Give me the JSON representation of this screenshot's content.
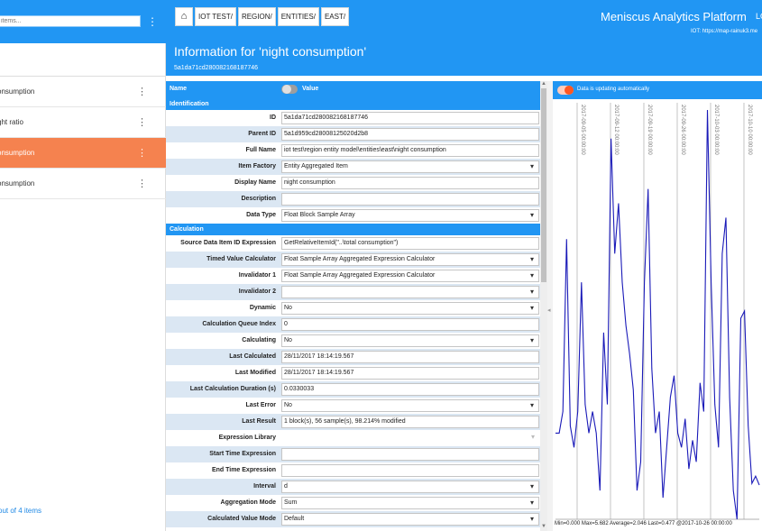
{
  "sidebar": {
    "search_placeholder": "items...",
    "items": [
      {
        "label": "onsumption",
        "active": false
      },
      {
        "label": "ght ratio",
        "active": false
      },
      {
        "label": "onsumption",
        "active": true
      },
      {
        "label": "onsumption",
        "active": false
      }
    ],
    "count_label": "out of 4 items"
  },
  "breadcrumbs": [
    "IOT TEST/",
    "REGION/",
    "ENTITIES/",
    "EAST/"
  ],
  "header": {
    "app_title": "Meniscus Analytics Platform",
    "user": "LO",
    "iot_url": "IOT: https://map-rainuk3.me",
    "page_title": "Information for 'night consumption'",
    "page_id": "5a1da71cd280082168187746"
  },
  "table": {
    "name_header": "Name",
    "value_header": "Value",
    "sections": [
      {
        "title": "Identification",
        "rows": [
          {
            "key": "ID",
            "value": "5a1da71cd280082168187746",
            "kind": "text"
          },
          {
            "key": "Parent ID",
            "value": "5a1d959cd28008125020d2b8",
            "kind": "text"
          },
          {
            "key": "Full Name",
            "value": "iot test\\region entity model\\entities\\east\\night consumption",
            "kind": "text"
          },
          {
            "key": "Item Factory",
            "value": "Entity Aggregated Item",
            "kind": "select"
          },
          {
            "key": "Display Name",
            "value": "night consumption",
            "kind": "text"
          },
          {
            "key": "Description",
            "value": "",
            "kind": "text"
          },
          {
            "key": "Data Type",
            "value": "Float Block Sample Array",
            "kind": "select"
          }
        ]
      },
      {
        "title": "Calculation",
        "rows": [
          {
            "key": "Source Data Item ID Expression",
            "value": "GetRelativeItemId(\"..\\total consumption\")",
            "kind": "text"
          },
          {
            "key": "Timed Value Calculator",
            "value": "Float Sample Array Aggregated Expression Calculator",
            "kind": "select"
          },
          {
            "key": "Invalidator 1",
            "value": "Float Sample Array Aggregated Expression Calculator",
            "kind": "select"
          },
          {
            "key": "Invalidator 2",
            "value": "",
            "kind": "select"
          },
          {
            "key": "Dynamic",
            "value": "No",
            "kind": "select"
          },
          {
            "key": "Calculation Queue Index",
            "value": "0",
            "kind": "text"
          },
          {
            "key": "Calculating",
            "value": "No",
            "kind": "select"
          },
          {
            "key": "Last Calculated",
            "value": "28/11/2017 18:14:19.567",
            "kind": "text"
          },
          {
            "key": "Last Modified",
            "value": "28/11/2017 18:14:19.567",
            "kind": "text"
          },
          {
            "key": "Last Calculation Duration (s)",
            "value": "0.0330033",
            "kind": "text"
          },
          {
            "key": "Last Error",
            "value": "No",
            "kind": "select"
          },
          {
            "key": "Last Result",
            "value": "1 block(s), 56 sample(s), 98.214% modified",
            "kind": "text"
          },
          {
            "key": "Expression Library",
            "value": "",
            "kind": "disabled"
          },
          {
            "key": "Start Time Expression",
            "value": "",
            "kind": "text"
          },
          {
            "key": "End Time Expression",
            "value": "",
            "kind": "text"
          },
          {
            "key": "Interval",
            "value": "d",
            "kind": "select"
          },
          {
            "key": "Aggregation Mode",
            "value": "Sum",
            "kind": "select"
          },
          {
            "key": "Calculated Value Mode",
            "value": "Default",
            "kind": "select"
          }
        ]
      }
    ]
  },
  "chart_panel": {
    "status": "Data is updating automatically",
    "stats": "Min=0.000  Max=5.682  Average=2.046  Last=0.477 @2017-10-26 00:00:00"
  },
  "chart_data": {
    "type": "line",
    "title": "",
    "xlabel": "",
    "ylabel": "",
    "color": "#1a1ab8",
    "x_tick_labels": [
      "2017-09-05 00:00:00",
      "2017-09-12 00:00:00",
      "2017-09-19 00:00:00",
      "2017-09-26 00:00:00",
      "2017-10-03 00:00:00",
      "2017-10-10 00:00:00"
    ],
    "ylim": [
      0,
      5.8
    ],
    "values": [
      1.2,
      1.2,
      1.5,
      3.9,
      1.3,
      1.0,
      1.5,
      3.3,
      1.6,
      1.2,
      1.5,
      1.2,
      0.4,
      2.6,
      1.6,
      5.3,
      3.7,
      4.4,
      3.3,
      2.7,
      2.3,
      1.8,
      0.4,
      0.8,
      3.3,
      4.6,
      2.1,
      1.2,
      1.5,
      0.3,
      1.0,
      1.7,
      2.0,
      1.2,
      1.0,
      1.4,
      0.7,
      1.1,
      0.8,
      1.9,
      1.5,
      5.7,
      3.3,
      1.6,
      1.0,
      3.7,
      4.2,
      1.7,
      0.4,
      0.0,
      2.8,
      2.9,
      1.3,
      0.5,
      0.6,
      0.477
    ]
  }
}
